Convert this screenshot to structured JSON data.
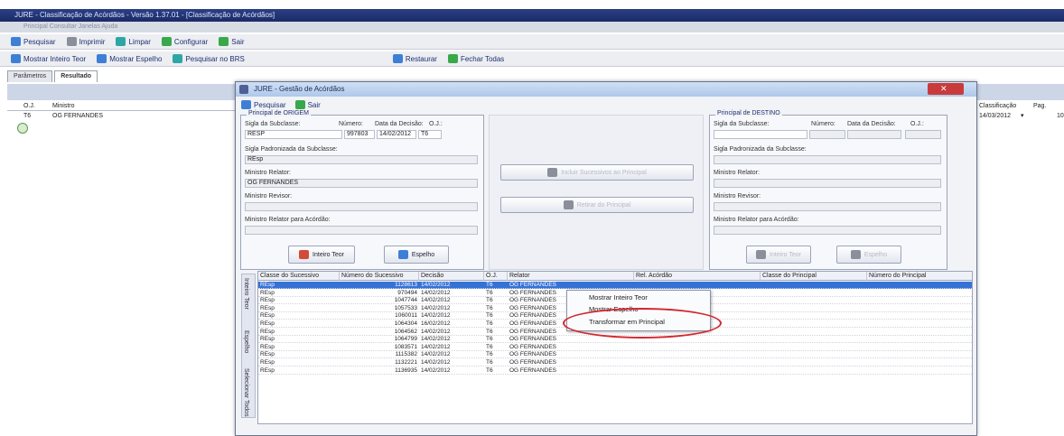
{
  "window": {
    "title": "JURE - Classificação de Acórdãos - Versão 1.37.01 - [Classificação de Acórdãos]",
    "menu": "Principal   Consultar   Janelas   Ajuda"
  },
  "toolbar1": {
    "pesquisar": "Pesquisar",
    "imprimir": "Imprimir",
    "limpar": "Limpar",
    "configurar": "Configurar",
    "sair": "Sair"
  },
  "toolbar2": {
    "mostrar_inteiro_teor": "Mostrar Inteiro Teor",
    "mostrar_espelho": "Mostrar Espelho",
    "pesquisar_brs": "Pesquisar no BRS",
    "restaurar": "Restaurar",
    "fechar_todas": "Fechar Todas"
  },
  "tabs": [
    "Parâmetros",
    "Resultado"
  ],
  "background_grid": {
    "columns": [
      "O.J.",
      "Ministro"
    ],
    "row": {
      "oj": "T6",
      "ministro": "OG FERNANDES"
    },
    "right_columns": [
      "Classificação",
      "Pag."
    ],
    "right_row": {
      "classificacao": "14/03/2012",
      "pag": "10"
    }
  },
  "dialog": {
    "title": "JURE - Gestão de Acórdãos",
    "pesquisar": "Pesquisar",
    "sair": "Sair",
    "origin": {
      "title": "Principal de ORIGEM",
      "sigla_label": "Sigla da Subclasse:",
      "numero_label": "Número:",
      "data_label": "Data da Decisão:",
      "oj_label": "O.J.:",
      "sigla": "RESP",
      "numero": "997803",
      "data": "14/02/2012",
      "oj": "T6",
      "sigla_pad_label": "Sigla Padronizada da Subclasse:",
      "sigla_pad": "REsp",
      "relator_label": "Ministro Relator:",
      "relator": "OG FERNANDES",
      "revisor_label": "Ministro Revisor:",
      "relator_acordao_label": "Ministro Relator para Acórdão:",
      "btn_inteiro_teor": "Inteiro Teor",
      "btn_espelho": "Espelho"
    },
    "middle": {
      "btn_add": "Incluir Sucessivos ao Principal",
      "btn_remove": "Retirar do Principal"
    },
    "dest": {
      "title": "Principal de DESTINO",
      "sigla_label": "Sigla da Subclasse:",
      "numero_label": "Número:",
      "data_label": "Data da Decisão:",
      "oj_label": "O.J.:",
      "sigla_pad_label": "Sigla Padronizada da Subclasse:",
      "relator_label": "Ministro Relator:",
      "revisor_label": "Ministro Revisor:",
      "relator_acordao_label": "Ministro Relator para Acórdão:",
      "btn_inteiro_teor": "Inteiro Teor",
      "btn_espelho": "Espelho"
    },
    "side_labels": [
      "Inteiro Teor",
      "Espelho",
      "Selecionar Todos"
    ],
    "grid": {
      "columns": [
        "Classe do Sucessivo",
        "Número do Sucessivo",
        "Decisão",
        "O.J.",
        "Relator",
        "Rel. Acórdão",
        "Classe do Principal",
        "Número do Principal"
      ],
      "rows": [
        {
          "classe": "REsp",
          "numero": "1128613",
          "decisao": "14/02/2012",
          "oj": "T6",
          "relator": "OG FERNANDES",
          "selected": true
        },
        {
          "classe": "REsp",
          "numero": "970494",
          "decisao": "14/02/2012",
          "oj": "T6",
          "relator": "OG FERNANDES"
        },
        {
          "classe": "REsp",
          "numero": "1047744",
          "decisao": "14/02/2012",
          "oj": "T6",
          "relator": "OG FERNANDES"
        },
        {
          "classe": "REsp",
          "numero": "1057533",
          "decisao": "14/02/2012",
          "oj": "T6",
          "relator": "OG FERNANDES"
        },
        {
          "classe": "REsp",
          "numero": "1060011",
          "decisao": "14/02/2012",
          "oj": "T6",
          "relator": "OG FERNANDES"
        },
        {
          "classe": "REsp",
          "numero": "1064304",
          "decisao": "16/02/2012",
          "oj": "T6",
          "relator": "OG FERNANDES"
        },
        {
          "classe": "REsp",
          "numero": "1064562",
          "decisao": "14/02/2012",
          "oj": "T6",
          "relator": "OG FERNANDES"
        },
        {
          "classe": "REsp",
          "numero": "1064799",
          "decisao": "14/02/2012",
          "oj": "T6",
          "relator": "OG FERNANDES"
        },
        {
          "classe": "REsp",
          "numero": "1083571",
          "decisao": "14/02/2012",
          "oj": "T6",
          "relator": "OG FERNANDES"
        },
        {
          "classe": "REsp",
          "numero": "1115382",
          "decisao": "14/02/2012",
          "oj": "T6",
          "relator": "OG FERNANDES"
        },
        {
          "classe": "REsp",
          "numero": "1132221",
          "decisao": "14/02/2012",
          "oj": "T6",
          "relator": "OG FERNANDES"
        },
        {
          "classe": "REsp",
          "numero": "1136935",
          "decisao": "14/02/2012",
          "oj": "T6",
          "relator": "OG FERNANDES"
        }
      ]
    },
    "context_menu": [
      "Mostrar Inteiro Teor",
      "Mostrar Espelho",
      "Transformar em Principal"
    ]
  },
  "colors": {
    "title_bar": "#1b2b66",
    "selection": "#3672d6",
    "highlight": "#d3262e"
  }
}
